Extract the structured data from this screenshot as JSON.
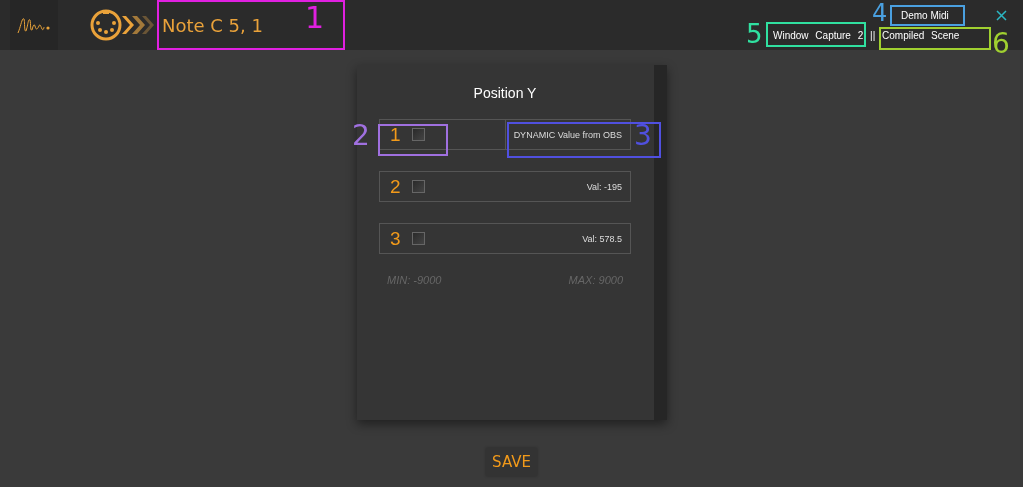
{
  "header": {
    "title": "Note C 5, 1",
    "device": "Demo Midi",
    "source": "Window Capture 2 || Compiled Scene"
  },
  "panel": {
    "title": "Position Y",
    "rows": [
      {
        "number": "1",
        "checked": false,
        "kind": "dynamic",
        "value": "DYNAMIC Value from OBS"
      },
      {
        "number": "2",
        "checked": false,
        "kind": "static",
        "value": "Val: -195"
      },
      {
        "number": "3",
        "checked": false,
        "kind": "static",
        "value": "Val: 578.5"
      }
    ],
    "min": "MIN: -9000",
    "max": "MAX: 9000"
  },
  "save_button": "SAVE",
  "annotations": [
    {
      "label": "1",
      "color": "#e020e0"
    },
    {
      "label": "2",
      "color": "#a070e0"
    },
    {
      "label": "3",
      "color": "#5050e0"
    },
    {
      "label": "4",
      "color": "#4aa0e0"
    },
    {
      "label": "5",
      "color": "#30e0a0"
    },
    {
      "label": "6",
      "color": "#a0d030"
    }
  ]
}
